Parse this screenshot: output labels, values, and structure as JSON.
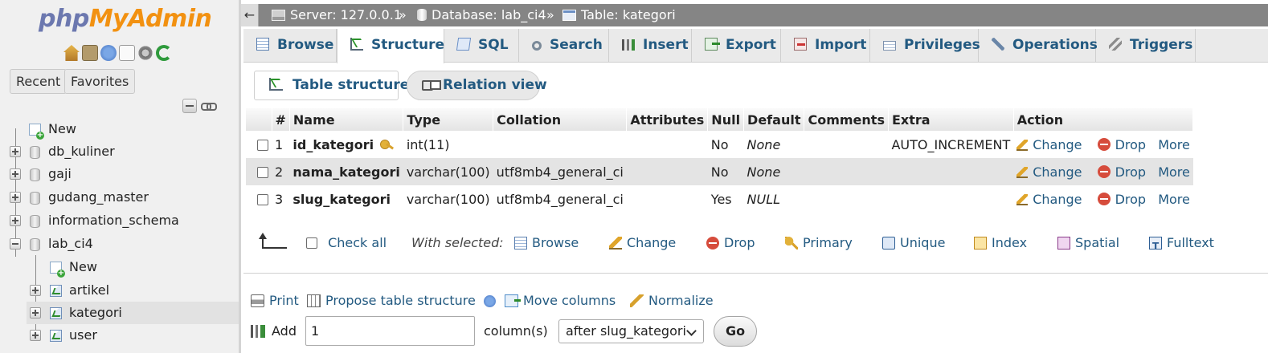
{
  "logo": {
    "part1": "php",
    "part2": "MyAdmin"
  },
  "nav": {
    "recent_label": "Recent",
    "favorites_label": "Favorites",
    "tree": [
      {
        "label": "New"
      },
      {
        "label": "db_kuliner"
      },
      {
        "label": "gaji"
      },
      {
        "label": "gudang_master"
      },
      {
        "label": "information_schema"
      },
      {
        "label": "lab_ci4"
      },
      {
        "label": "New"
      },
      {
        "label": "artikel"
      },
      {
        "label": "kategori"
      },
      {
        "label": "user"
      }
    ]
  },
  "breadcrumb": {
    "back": "←",
    "server": "Server: 127.0.0.1",
    "database": "Database: lab_ci4",
    "table": "Table: kategori",
    "separator": "»"
  },
  "tabs": [
    "Browse",
    "Structure",
    "SQL",
    "Search",
    "Insert",
    "Export",
    "Import",
    "Privileges",
    "Operations",
    "Triggers"
  ],
  "active_tab": "Structure",
  "subtabs": {
    "table_structure": "Table structure",
    "relation_view": "Relation view"
  },
  "table": {
    "headers": [
      "#",
      "Name",
      "Type",
      "Collation",
      "Attributes",
      "Null",
      "Default",
      "Comments",
      "Extra",
      "Action"
    ],
    "rows": [
      {
        "num": "1",
        "name": "id_kategori",
        "type": "int(11)",
        "collation": "",
        "attributes": "",
        "null": "No",
        "default": "None",
        "comments": "",
        "extra": "AUTO_INCREMENT",
        "change": "Change",
        "drop": "Drop",
        "more": "More"
      },
      {
        "num": "2",
        "name": "nama_kategori",
        "type": "varchar(100)",
        "collation": "utf8mb4_general_ci",
        "attributes": "",
        "null": "No",
        "default": "None",
        "comments": "",
        "extra": "",
        "change": "Change",
        "drop": "Drop",
        "more": "More"
      },
      {
        "num": "3",
        "name": "slug_kategori",
        "type": "varchar(100)",
        "collation": "utf8mb4_general_ci",
        "attributes": "",
        "null": "Yes",
        "default": "NULL",
        "comments": "",
        "extra": "",
        "change": "Change",
        "drop": "Drop",
        "more": "More"
      }
    ]
  },
  "with_selected": {
    "check_all": "Check all",
    "label": "With selected:",
    "actions": [
      "Browse",
      "Change",
      "Drop",
      "Primary",
      "Unique",
      "Index",
      "Spatial",
      "Fulltext"
    ]
  },
  "table_actions": {
    "print": "Print",
    "propose": "Propose table structure",
    "move_columns": "Move columns",
    "normalize": "Normalize"
  },
  "add_columns": {
    "add_label": "Add",
    "count": "1",
    "columns_label": "column(s)",
    "position": "after slug_kategori",
    "go": "Go"
  }
}
